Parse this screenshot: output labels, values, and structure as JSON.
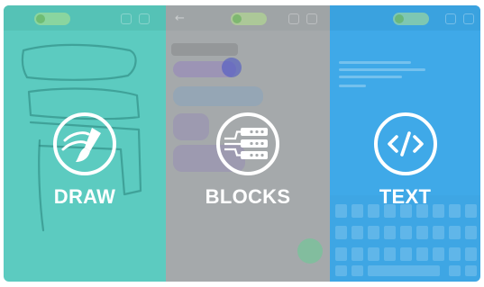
{
  "panels": {
    "draw": {
      "label": "DRAW",
      "icon": "paintbrush-icon",
      "color": "#5ccbc0"
    },
    "blocks": {
      "label": "BLOCKS",
      "icon": "code-blocks-icon",
      "color": "#a5a9ab"
    },
    "text": {
      "label": "TEXT",
      "icon": "code-brackets-icon",
      "color": "#3fa9e8"
    }
  }
}
